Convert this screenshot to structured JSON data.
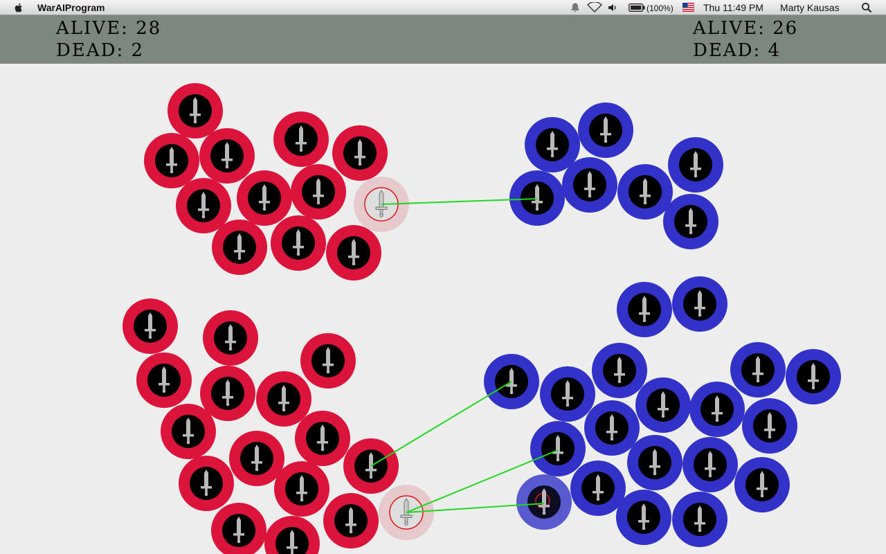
{
  "menubar": {
    "app_name": "WarAIProgram",
    "battery": "(100%)",
    "clock": "Thu 11:49 PM",
    "user": "Marty Kausas",
    "icons": [
      "apple-icon",
      "bell-icon",
      "wifi-icon",
      "volume-icon",
      "battery-icon",
      "flag-icon",
      "search-icon"
    ]
  },
  "hud": {
    "red": {
      "alive_label": "ALIVE: 28",
      "dead_label": "DEAD: 2"
    },
    "blue": {
      "alive_label": "ALIVE: 26",
      "dead_label": "DEAD: 4"
    }
  },
  "colors": {
    "red_team": "#dc143c",
    "blue_team": "#3232c8",
    "unit_core": "#000000",
    "sword": "#b9b9b9",
    "attack_line": "#1ed81e",
    "background": "#ededed",
    "hud": "#7e8681"
  },
  "units": {
    "red": [
      [
        282,
        160
      ],
      [
        248,
        232
      ],
      [
        328,
        225
      ],
      [
        435,
        201
      ],
      [
        520,
        221
      ],
      [
        294,
        297
      ],
      [
        382,
        286
      ],
      [
        460,
        277
      ],
      [
        346,
        357
      ],
      [
        431,
        351
      ],
      [
        511,
        365
      ],
      [
        217,
        471
      ],
      [
        333,
        488
      ],
      [
        474,
        521
      ],
      [
        237,
        549
      ],
      [
        329,
        568
      ],
      [
        410,
        576
      ],
      [
        272,
        623
      ],
      [
        466,
        633
      ],
      [
        371,
        662
      ],
      [
        536,
        673
      ],
      [
        298,
        698
      ],
      [
        436,
        706
      ],
      [
        507,
        752
      ],
      [
        345,
        766
      ],
      [
        422,
        785
      ]
    ],
    "red_selected": [
      [
        551,
        295
      ],
      [
        587,
        740
      ]
    ],
    "blue": [
      [
        798,
        209
      ],
      [
        875,
        188
      ],
      [
        1005,
        238
      ],
      [
        776,
        286
      ],
      [
        852,
        267
      ],
      [
        932,
        277
      ],
      [
        998,
        320
      ],
      [
        931,
        447
      ],
      [
        1011,
        439
      ],
      [
        739,
        551
      ],
      [
        820,
        569
      ],
      [
        895,
        535
      ],
      [
        958,
        585
      ],
      [
        1036,
        591
      ],
      [
        1095,
        534
      ],
      [
        1175,
        544
      ],
      [
        884,
        618
      ],
      [
        1112,
        615
      ],
      [
        806,
        648
      ],
      [
        946,
        668
      ],
      [
        1026,
        671
      ],
      [
        864,
        705
      ],
      [
        1101,
        700
      ],
      [
        930,
        747
      ],
      [
        1011,
        750
      ]
    ],
    "blue_selected": [
      [
        786,
        725
      ]
    ],
    "attacks": [
      [
        [
          551,
          295
        ],
        [
          776,
          287
        ]
      ],
      [
        [
          536,
          673
        ],
        [
          739,
          551
        ]
      ],
      [
        [
          587,
          740
        ],
        [
          806,
          650
        ]
      ],
      [
        [
          587,
          740
        ],
        [
          786,
          727
        ]
      ]
    ]
  }
}
